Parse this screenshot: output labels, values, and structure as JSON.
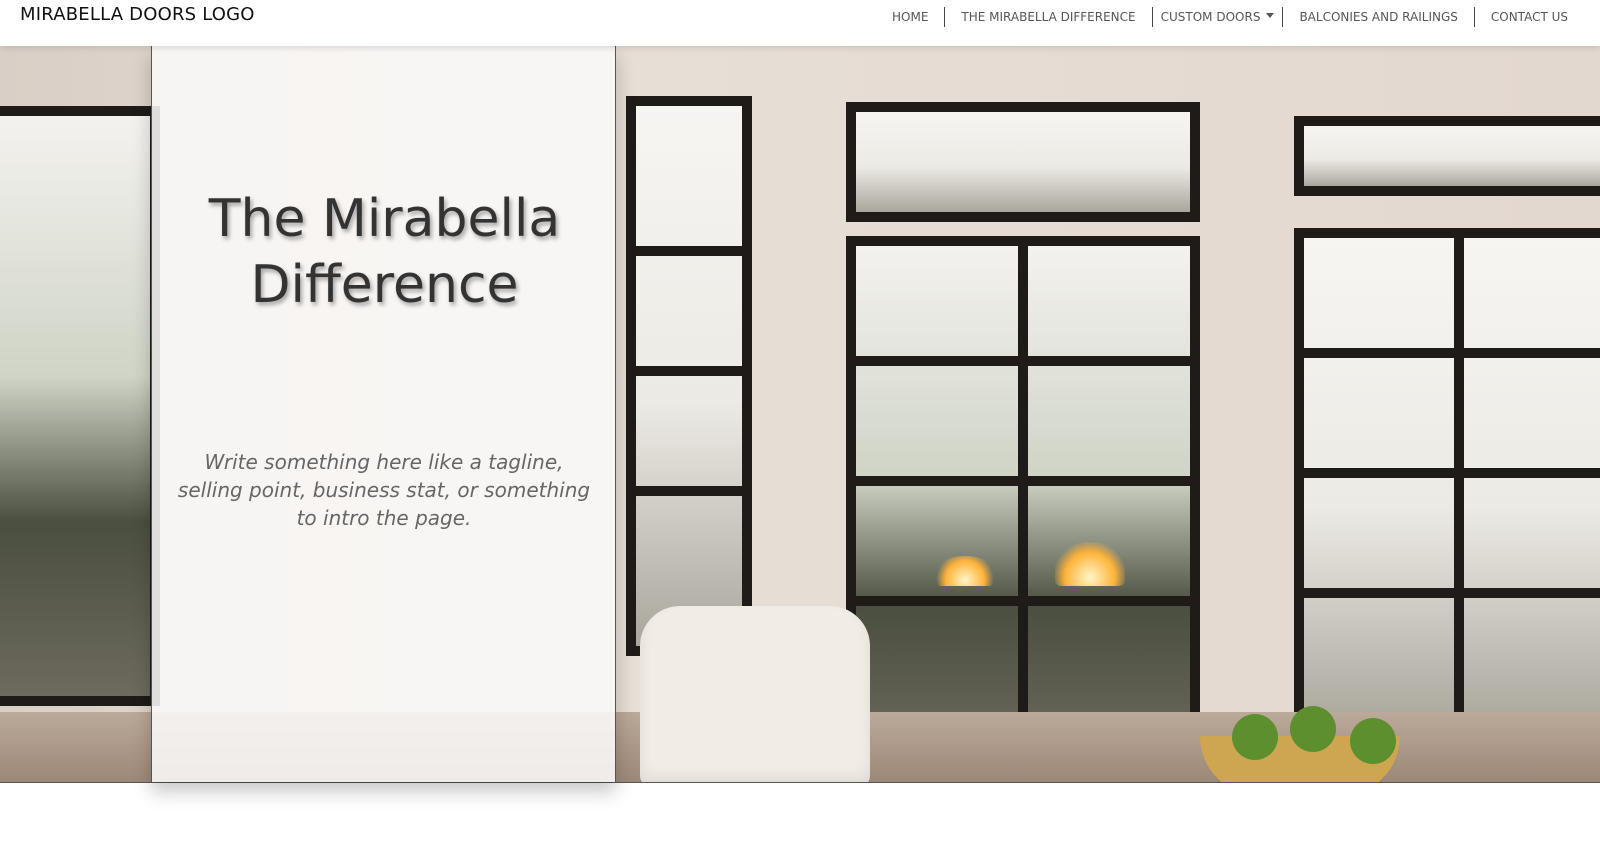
{
  "header": {
    "logo": "MIRABELLA DOORS LOGO",
    "nav": [
      {
        "label": "HOME"
      },
      {
        "label": "THE MIRABELLA DIFFERENCE"
      },
      {
        "label": "CUSTOM DOORS",
        "dropdown": true
      },
      {
        "label": "BALCONIES AND RAILINGS"
      },
      {
        "label": "CONTACT US"
      }
    ]
  },
  "hero": {
    "title": "The Mirabella Difference",
    "tagline": "Write something here like a tagline, selling point, business stat, or something to intro the page."
  },
  "colors": {
    "nav_text": "#555555",
    "title_text": "#333333",
    "tagline_text": "#666666",
    "frame_dark": "#1e1b19"
  }
}
